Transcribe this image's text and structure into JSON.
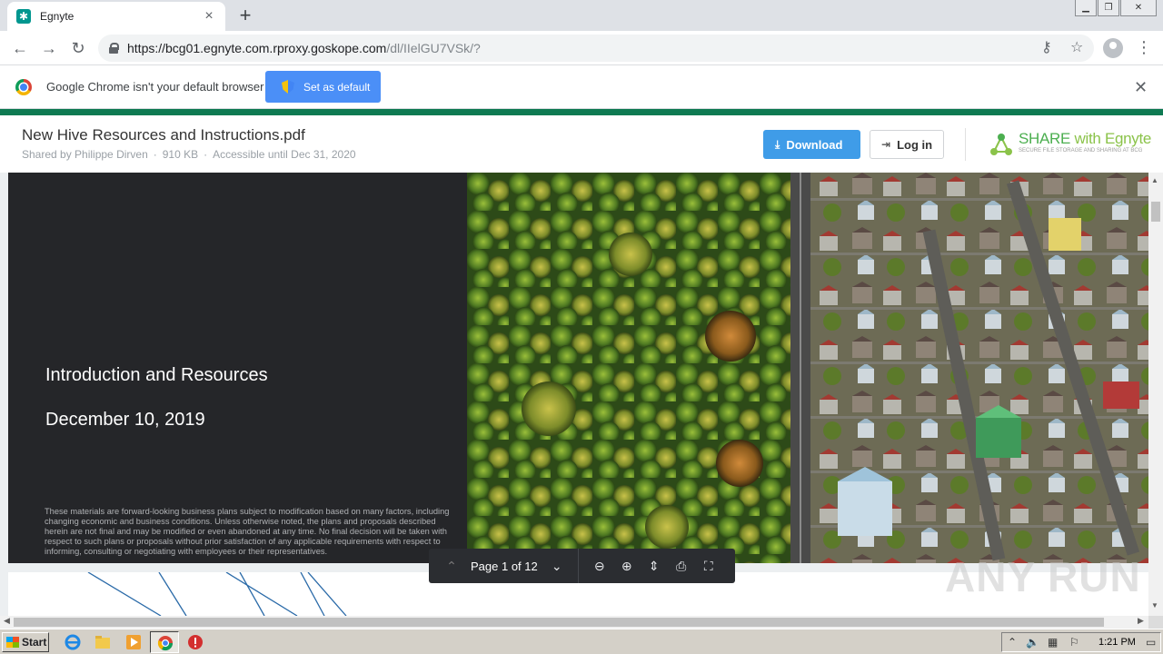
{
  "browser": {
    "tab_title": "Egnyte",
    "url_host": "https://bcg01.egnyte.com.rproxy.goskope.com",
    "url_path": "/dl/IIelGU7VSk/?"
  },
  "infobar": {
    "message": "Google Chrome isn't your default browser",
    "button_label": "Set as default"
  },
  "header": {
    "doc_title": "New Hive Resources and Instructions.pdf",
    "shared_by": "Shared by Philippe Dirven",
    "file_size": "910 KB",
    "accessible_until": "Accessible until Dec 31, 2020",
    "download_label": "Download",
    "login_label": "Log in",
    "brand_share": "SHARE",
    "brand_with": " with Egnyte",
    "brand_tagline": "SECURE FILE STORAGE AND SHARING AT BCG"
  },
  "slide": {
    "title": "Introduction and Resources",
    "date": "December 10, 2019",
    "disclaimer": "These materials are forward-looking business plans subject to modification based on many factors, including changing economic and business conditions. Unless otherwise noted, the plans and proposals described herein are not final and may be modified or even abandoned at any time. No final decision will be taken with respect to such plans or proposals without prior satisfaction of any applicable requirements with respect to informing, consulting or negotiating with employees or their representatives."
  },
  "viewer": {
    "page_indicator": "Page 1 of 12"
  },
  "watermark": "ANY RUN",
  "taskbar": {
    "start_label": "Start",
    "clock": "1:21 PM"
  },
  "colors": {
    "accent_green": "#0e7a52",
    "download_blue": "#3f9ce8",
    "set_default_blue": "#4b8ff7",
    "slide_dark": "#252629"
  }
}
